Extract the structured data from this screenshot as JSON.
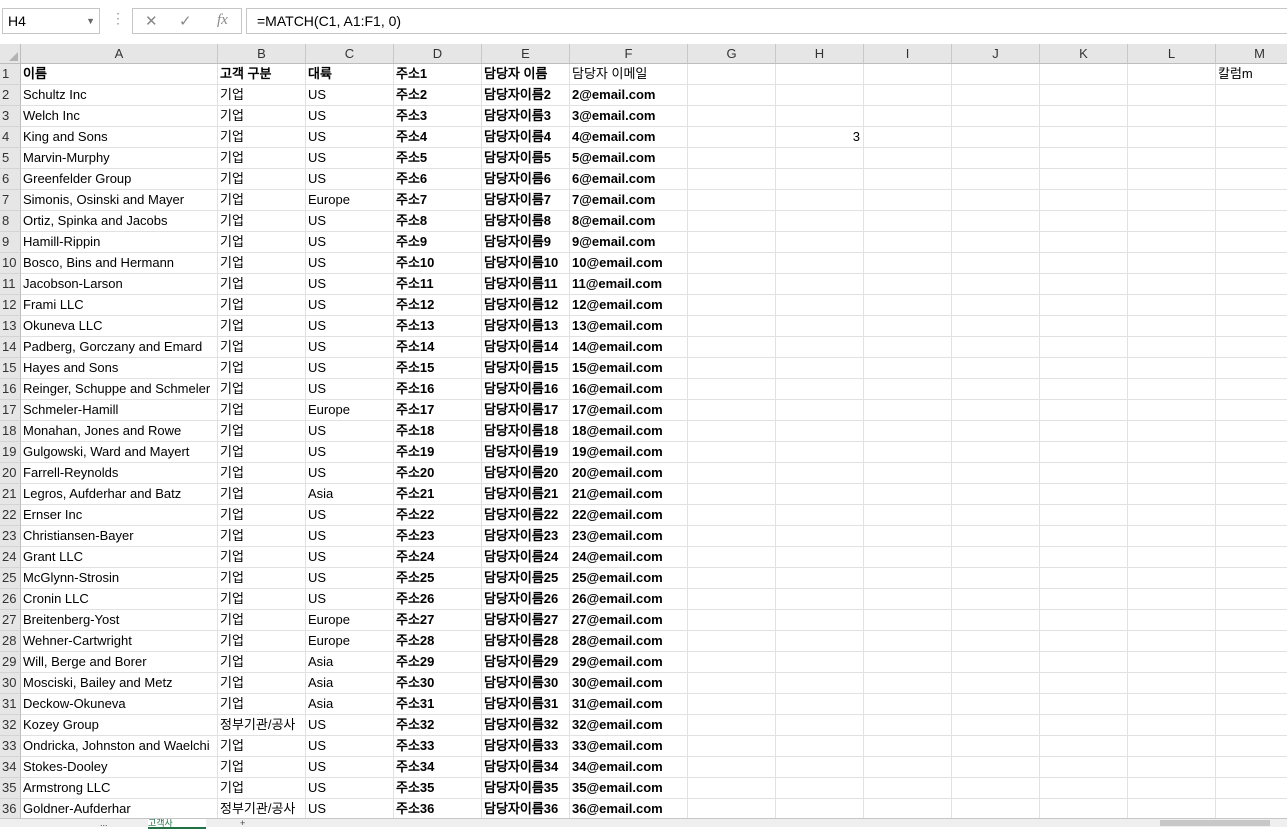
{
  "formula_bar": {
    "name_box": "H4",
    "cancel_icon": "✕",
    "enter_icon": "✓",
    "fx_label": "fx",
    "formula": "=MATCH(C1, A1:F1, 0)"
  },
  "columns": [
    {
      "letter": "A"
    },
    {
      "letter": "B"
    },
    {
      "letter": "C"
    },
    {
      "letter": "D"
    },
    {
      "letter": "E"
    },
    {
      "letter": "F"
    },
    {
      "letter": "G"
    },
    {
      "letter": "H"
    },
    {
      "letter": "I"
    },
    {
      "letter": "J"
    },
    {
      "letter": "K"
    },
    {
      "letter": "L"
    },
    {
      "letter": "M"
    }
  ],
  "header_row": [
    "이름",
    "고객 구분",
    "대륙",
    "주소1",
    "담당자 이름",
    "담당자 이메일"
  ],
  "m1_value": "칼럼m",
  "h4_value": "3",
  "rows": [
    [
      "Schultz Inc",
      "기업",
      "US",
      "주소2",
      "담당자이름2",
      "2@email.com"
    ],
    [
      "Welch Inc",
      "기업",
      "US",
      "주소3",
      "담당자이름3",
      "3@email.com"
    ],
    [
      "King and Sons",
      "기업",
      "US",
      "주소4",
      "담당자이름4",
      "4@email.com"
    ],
    [
      "Marvin-Murphy",
      "기업",
      "US",
      "주소5",
      "담당자이름5",
      "5@email.com"
    ],
    [
      "Greenfelder Group",
      "기업",
      "US",
      "주소6",
      "담당자이름6",
      "6@email.com"
    ],
    [
      "Simonis, Osinski and Mayer",
      "기업",
      "Europe",
      "주소7",
      "담당자이름7",
      "7@email.com"
    ],
    [
      "Ortiz, Spinka and Jacobs",
      "기업",
      "US",
      "주소8",
      "담당자이름8",
      "8@email.com"
    ],
    [
      "Hamill-Rippin",
      "기업",
      "US",
      "주소9",
      "담당자이름9",
      "9@email.com"
    ],
    [
      "Bosco, Bins and Hermann",
      "기업",
      "US",
      "주소10",
      "담당자이름10",
      "10@email.com"
    ],
    [
      "Jacobson-Larson",
      "기업",
      "US",
      "주소11",
      "담당자이름11",
      "11@email.com"
    ],
    [
      "Frami LLC",
      "기업",
      "US",
      "주소12",
      "담당자이름12",
      "12@email.com"
    ],
    [
      "Okuneva LLC",
      "기업",
      "US",
      "주소13",
      "담당자이름13",
      "13@email.com"
    ],
    [
      "Padberg, Gorczany and Emard",
      "기업",
      "US",
      "주소14",
      "담당자이름14",
      "14@email.com"
    ],
    [
      "Hayes and Sons",
      "기업",
      "US",
      "주소15",
      "담당자이름15",
      "15@email.com"
    ],
    [
      "Reinger, Schuppe and Schmeler",
      "기업",
      "US",
      "주소16",
      "담당자이름16",
      "16@email.com"
    ],
    [
      "Schmeler-Hamill",
      "기업",
      "Europe",
      "주소17",
      "담당자이름17",
      "17@email.com"
    ],
    [
      "Monahan, Jones and Rowe",
      "기업",
      "US",
      "주소18",
      "담당자이름18",
      "18@email.com"
    ],
    [
      "Gulgowski, Ward and Mayert",
      "기업",
      "US",
      "주소19",
      "담당자이름19",
      "19@email.com"
    ],
    [
      "Farrell-Reynolds",
      "기업",
      "US",
      "주소20",
      "담당자이름20",
      "20@email.com"
    ],
    [
      "Legros, Aufderhar and Batz",
      "기업",
      "Asia",
      "주소21",
      "담당자이름21",
      "21@email.com"
    ],
    [
      "Ernser Inc",
      "기업",
      "US",
      "주소22",
      "담당자이름22",
      "22@email.com"
    ],
    [
      "Christiansen-Bayer",
      "기업",
      "US",
      "주소23",
      "담당자이름23",
      "23@email.com"
    ],
    [
      "Grant LLC",
      "기업",
      "US",
      "주소24",
      "담당자이름24",
      "24@email.com"
    ],
    [
      "McGlynn-Strosin",
      "기업",
      "US",
      "주소25",
      "담당자이름25",
      "25@email.com"
    ],
    [
      "Cronin LLC",
      "기업",
      "US",
      "주소26",
      "담당자이름26",
      "26@email.com"
    ],
    [
      "Breitenberg-Yost",
      "기업",
      "Europe",
      "주소27",
      "담당자이름27",
      "27@email.com"
    ],
    [
      "Wehner-Cartwright",
      "기업",
      "Europe",
      "주소28",
      "담당자이름28",
      "28@email.com"
    ],
    [
      "Will, Berge and Borer",
      "기업",
      "Asia",
      "주소29",
      "담당자이름29",
      "29@email.com"
    ],
    [
      "Mosciski, Bailey and Metz",
      "기업",
      "Asia",
      "주소30",
      "담당자이름30",
      "30@email.com"
    ],
    [
      "Deckow-Okuneva",
      "기업",
      "Asia",
      "주소31",
      "담당자이름31",
      "31@email.com"
    ],
    [
      "Kozey Group",
      "정부기관/공사",
      "US",
      "주소32",
      "담당자이름32",
      "32@email.com"
    ],
    [
      "Ondricka, Johnston and Waelchi",
      "기업",
      "US",
      "주소33",
      "담당자이름33",
      "33@email.com"
    ],
    [
      "Stokes-Dooley",
      "기업",
      "US",
      "주소34",
      "담당자이름34",
      "34@email.com"
    ],
    [
      "Armstrong LLC",
      "기업",
      "US",
      "주소35",
      "담당자이름35",
      "35@email.com"
    ],
    [
      "Goldner-Aufderhar",
      "정부기관/공사",
      "US",
      "주소36",
      "담당자이름36",
      "36@email.com"
    ]
  ],
  "sheet_tabs": [
    "...",
    "고객사",
    "+"
  ]
}
